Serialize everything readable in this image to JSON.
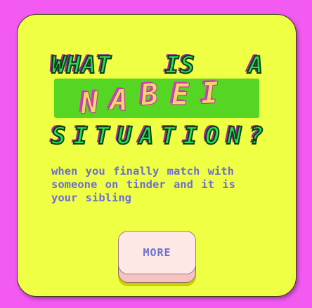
{
  "headline": {
    "line1": [
      "WHAT",
      "IS",
      "A"
    ],
    "word_letters": [
      "N",
      "A",
      "B",
      "E",
      "I"
    ],
    "line3": [
      "S",
      "I",
      "T",
      "U",
      "A",
      "T",
      "I",
      "O",
      "N",
      "?"
    ]
  },
  "description": "when you finally match with someone on tinder and it is your sibling",
  "more_button": {
    "label": "MORE"
  },
  "colors": {
    "page_background": "#f25af2",
    "card_background": "#eeff44",
    "headline_fill": "#22e05a",
    "word_highlight": "#55d622",
    "word_letters": "#f4d56a",
    "description_text": "#6e6fd0",
    "button_face": "#fde8e6"
  }
}
